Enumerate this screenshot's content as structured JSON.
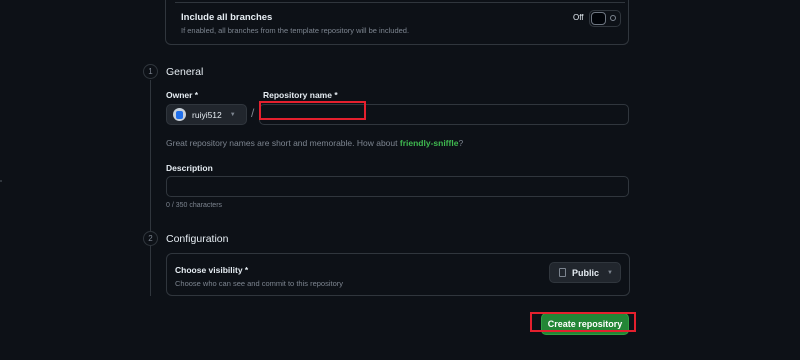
{
  "template": {
    "branches_title": "Include all branches",
    "branches_desc": "If enabled, all branches from the template repository will be included.",
    "toggle_state": "Off"
  },
  "general": {
    "step": "1",
    "title": "General",
    "owner_label": "Owner *",
    "owner_value": "ruiyi512",
    "separator": "/",
    "repo_label": "Repository name *",
    "repo_value": "",
    "hint_prefix": "Great repository names are short and memorable. How about ",
    "hint_suggestion": "friendly-sniffle",
    "hint_suffix": "?",
    "description_label": "Description",
    "description_value": "",
    "char_count": "0 / 350 characters"
  },
  "configuration": {
    "step": "2",
    "title": "Configuration",
    "visibility_label": "Choose visibility *",
    "visibility_desc": "Choose who can see and commit to this repository",
    "visibility_value": "Public"
  },
  "actions": {
    "create_label": "Create repository"
  },
  "colors": {
    "background": "#0d1117",
    "border": "#30363d",
    "accent_green": "#238636",
    "suggestion_green": "#3fb950",
    "highlight_red": "#e5202e"
  }
}
